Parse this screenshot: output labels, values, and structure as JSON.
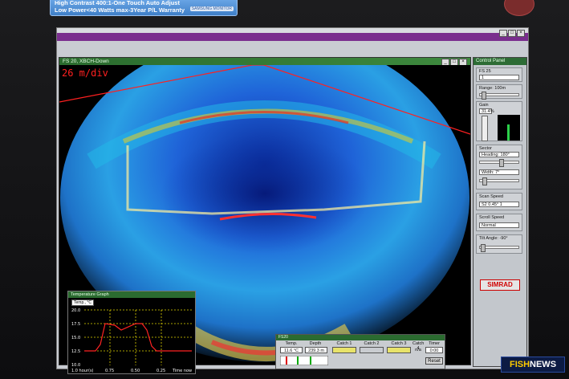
{
  "monitor": {
    "sticker_line1": "High Contrast 400:1-One Touch Auto Adjust",
    "sticker_line2": "Low Power<40 Watts max-3Year P/L Warranty",
    "sticker_tag": "SAMSUNG MONITOR"
  },
  "sonar_window": {
    "title": "FS 20, XBCH-Down",
    "scale_label": "26 m/div"
  },
  "control_panel": {
    "title": "Control Panel",
    "fs_label": "FS 25",
    "fs_value": "1",
    "range_label": "Range: 100m",
    "gain_label": "Gain",
    "gain_value": "31.4%",
    "sector_label": "Sector",
    "heading_label": "Heading: 180°",
    "width_label": "Width: 7°",
    "scan_speed_label": "Scan Speed",
    "scan_speed_value": "S2  0.45° 1",
    "scroll_speed_label": "Scroll Speed",
    "scroll_speed_value": "Normal",
    "tilt_label": "Tilt Angle: -90°",
    "brand": "SIMRAD"
  },
  "temperature_graph": {
    "title": "Temperature Graph",
    "unit_label": "Temp., °C",
    "y_ticks": [
      "20.0",
      "17.5",
      "15.0",
      "12.5",
      "10.0"
    ],
    "x_ticks": [
      "1.0 hour(s)",
      "0.75",
      "0.50",
      "0.25",
      "Time now"
    ]
  },
  "fs_status": {
    "title": "FS20",
    "columns": [
      "Temp.",
      "Depth",
      "Catch 1",
      "Catch 2",
      "Catch 3",
      "Catch 4",
      "Timer"
    ],
    "temp_value": "11.6 °C",
    "depth_value": "239.3 m",
    "catch4_value": "n/a",
    "timer_value": "0:00",
    "reset_label": "Reset"
  },
  "watermark": {
    "prefix": "FISH",
    "suffix": "NEWS"
  },
  "colors": {
    "titlebar": "#2d6c35",
    "purple_bar": "#7a2e8e",
    "sonar_red": "#ff2020",
    "brand_red": "#d10000"
  }
}
